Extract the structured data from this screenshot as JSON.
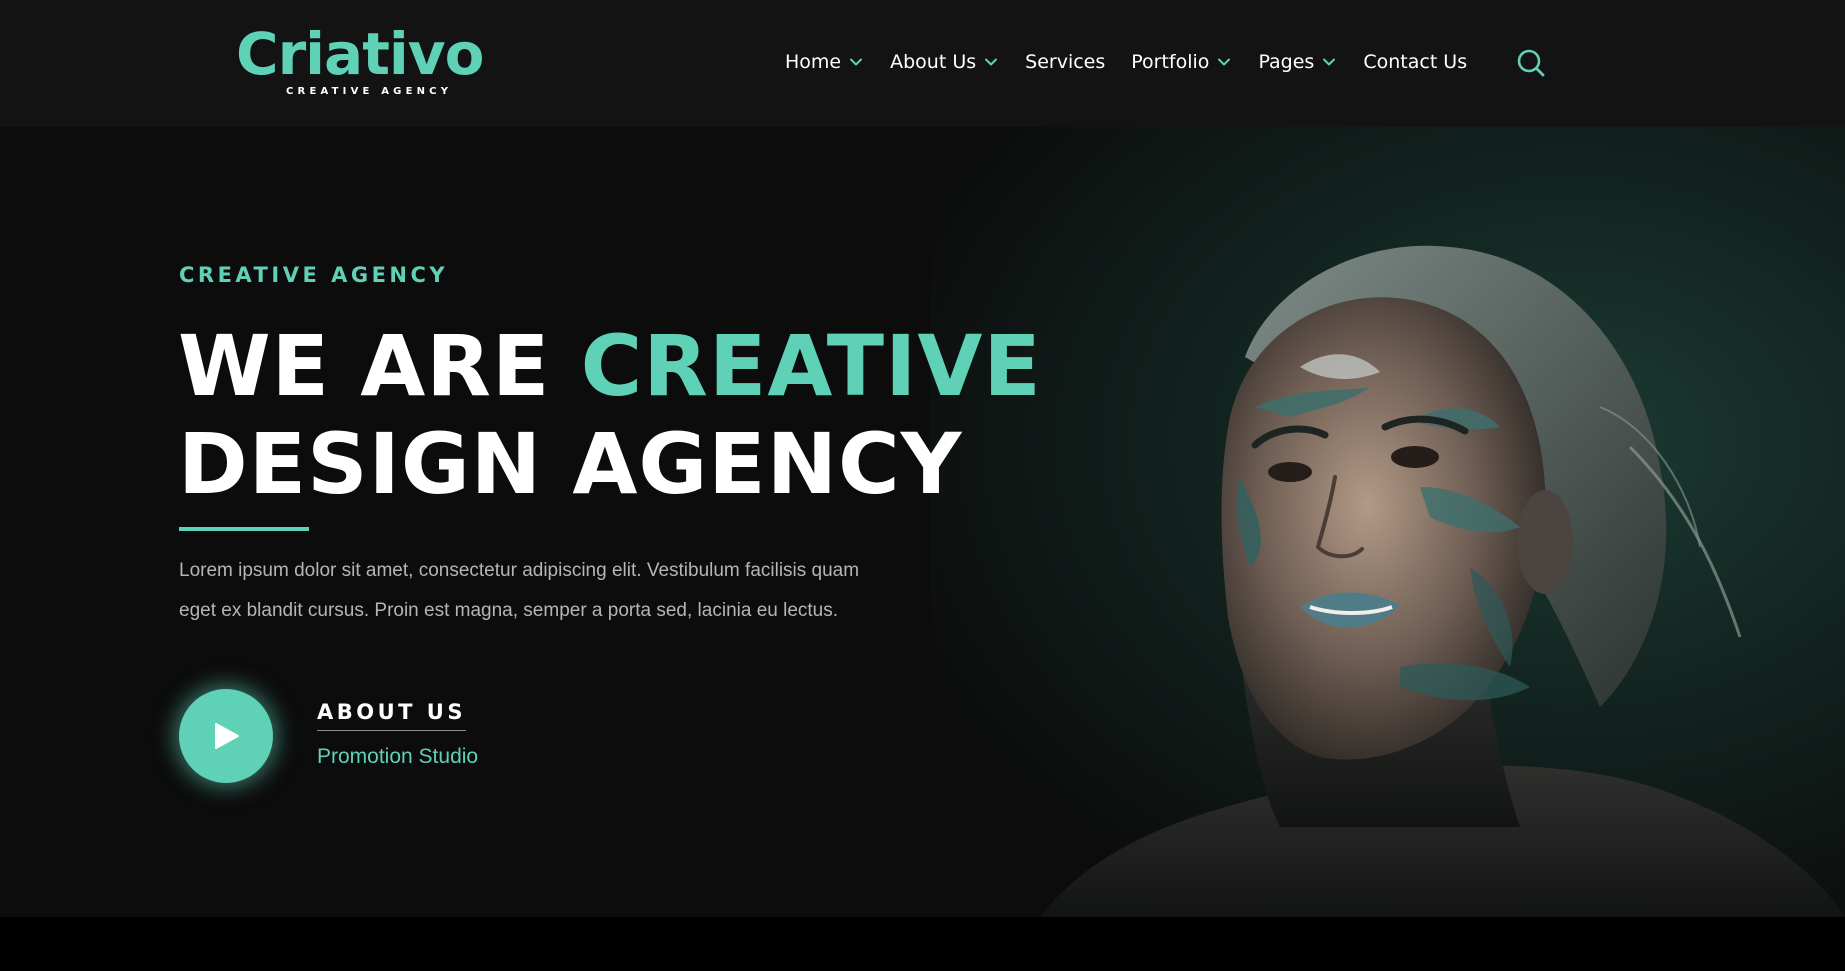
{
  "brand": {
    "name": "Criativo",
    "tagline": "CREATIVE AGENCY",
    "accent_color": "#5ed1b6",
    "header_background": "#131313",
    "hero_background": "#0c0c0c"
  },
  "nav": {
    "items": [
      {
        "label": "Home",
        "has_dropdown": true
      },
      {
        "label": "About Us",
        "has_dropdown": true
      },
      {
        "label": "Services",
        "has_dropdown": false
      },
      {
        "label": "Portfolio",
        "has_dropdown": true
      },
      {
        "label": "Pages",
        "has_dropdown": true
      },
      {
        "label": "Contact Us",
        "has_dropdown": false
      }
    ],
    "search_icon": "search-icon"
  },
  "hero": {
    "eyebrow": "CREATIVE AGENCY",
    "headline_part1": "WE ARE ",
    "headline_accent": "CREATIVE",
    "headline_line2": "DESIGN AGENCY",
    "description": "Lorem ipsum dolor sit amet, consectetur adipiscing elit. Vestibulum facilisis quam eget ex blandit cursus. Proin est magna, semper a porta sed, lacinia eu lectus.",
    "play_icon": "play-icon",
    "cta_title": "ABOUT US",
    "cta_subtitle": "Promotion Studio",
    "image": "portrait-photo"
  }
}
